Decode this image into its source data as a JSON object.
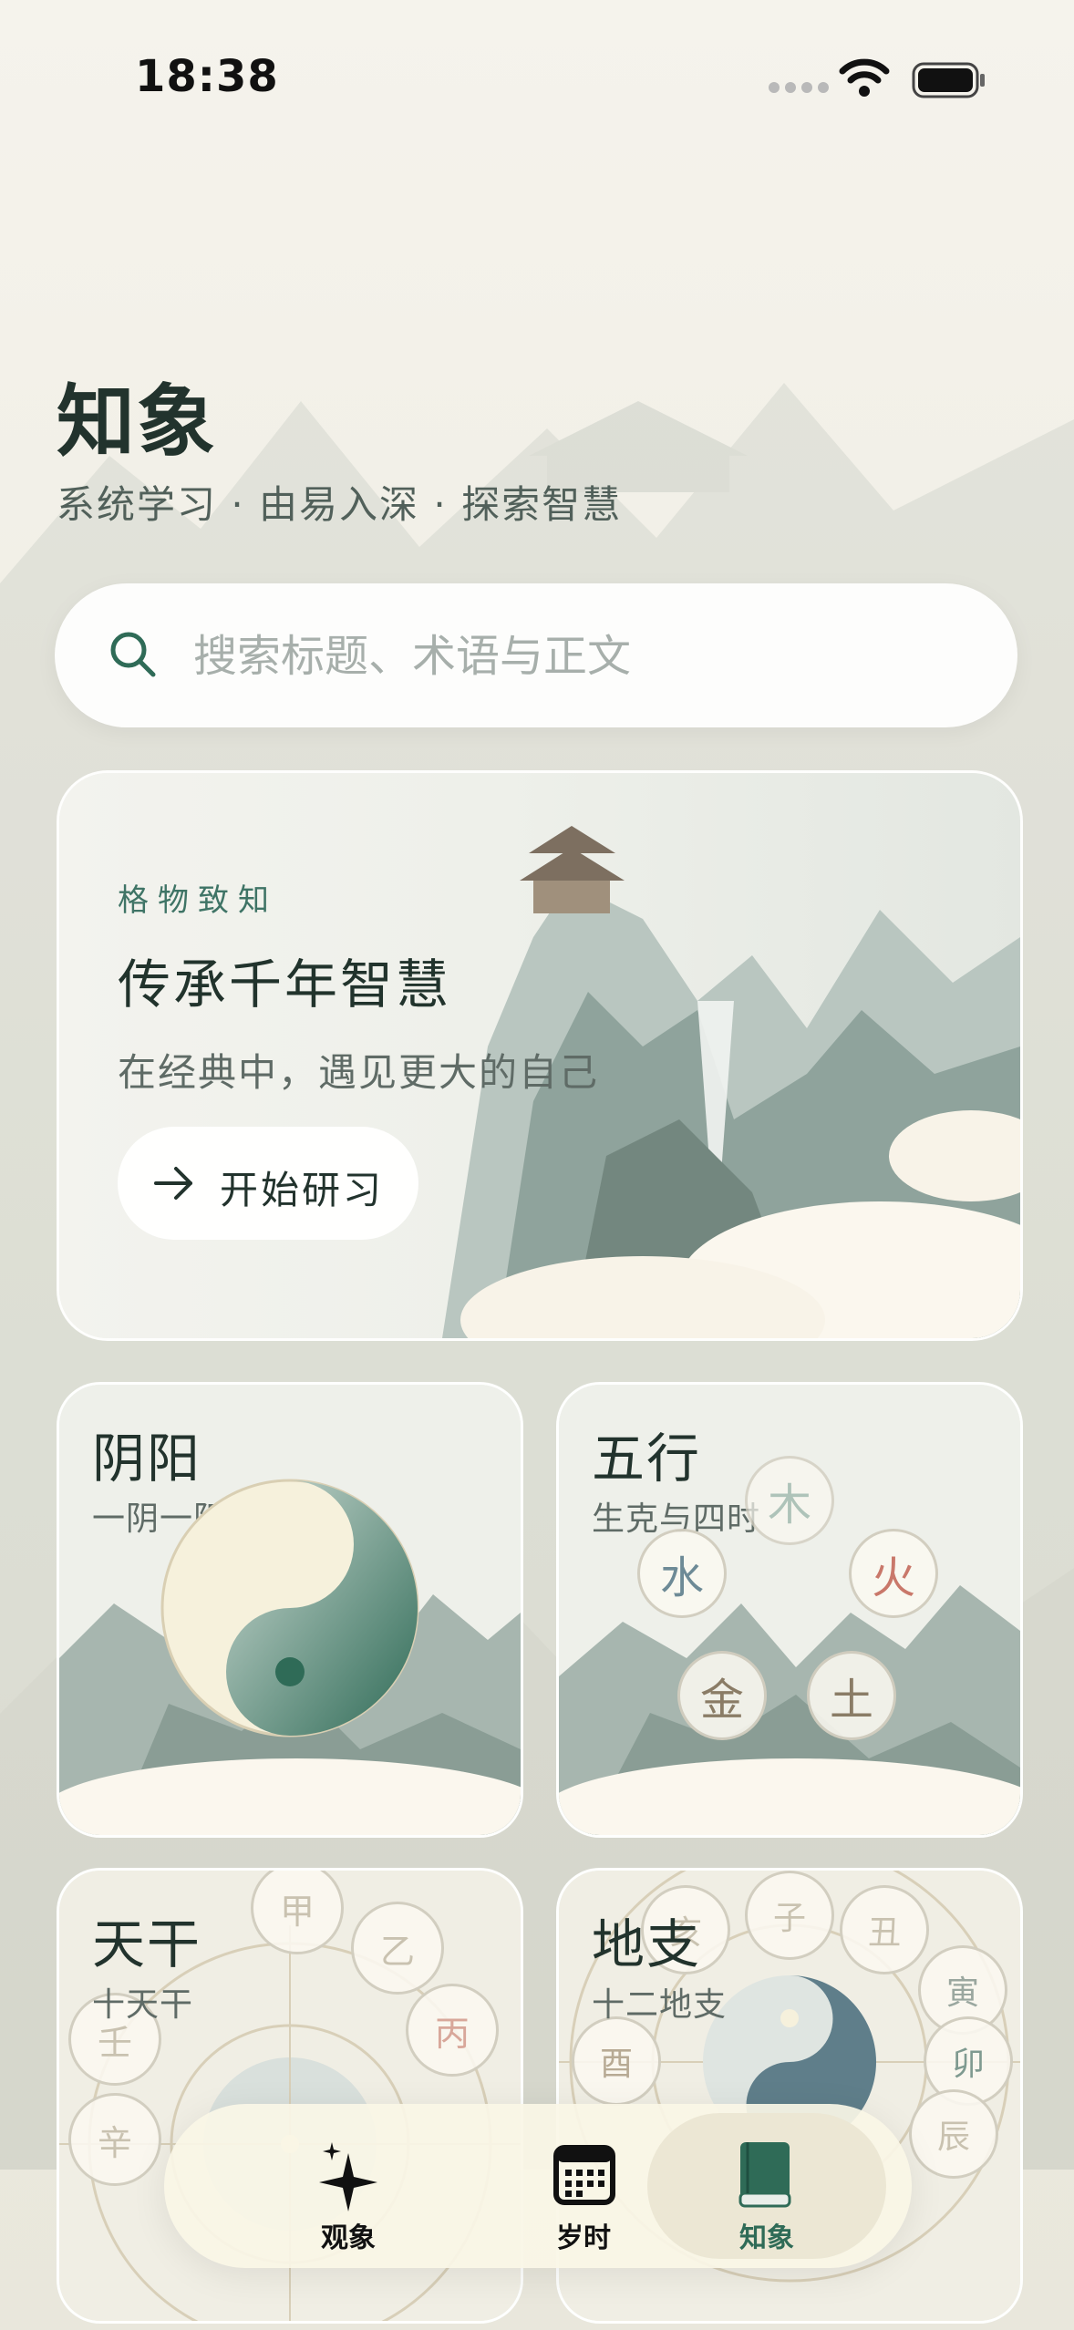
{
  "status_bar": {
    "time": "18:38"
  },
  "header": {
    "title": "知象",
    "subtitle": "系统学习 · 由易入深 · 探索智慧"
  },
  "search": {
    "placeholder": "搜索标题、术语与正文",
    "icon": "search-icon"
  },
  "hero": {
    "tag": "格物致知",
    "title": "传承千年智慧",
    "subtitle": "在经典中，遇见更大的自己",
    "button_label": "开始研习"
  },
  "cards": {
    "yinyang": {
      "title": "阴阳",
      "subtitle": "一阴一阳"
    },
    "wuxing": {
      "title": "五行",
      "subtitle": "生克与四时",
      "elements": {
        "wood": "木",
        "water": "水",
        "fire": "火",
        "metal": "金",
        "earth": "土"
      }
    },
    "tiangan": {
      "title": "天干",
      "subtitle": "十天干",
      "stems": {
        "jia": "甲",
        "yi": "乙",
        "bing": "丙",
        "ren": "壬",
        "xin": "辛"
      }
    },
    "dizhi": {
      "title": "地支",
      "subtitle": "十二地支",
      "branches": {
        "hai": "亥",
        "zi": "子",
        "chou": "丑",
        "yin": "寅",
        "you": "酉",
        "mao": "卯",
        "chen": "辰"
      }
    }
  },
  "tabbar": {
    "tabs": [
      {
        "label": "观象",
        "icon": "sparkle-icon"
      },
      {
        "label": "岁时",
        "icon": "calendar-icon"
      },
      {
        "label": "知象",
        "icon": "book-icon",
        "active": true
      }
    ]
  },
  "colors": {
    "accent": "#2f6b57",
    "title": "#22332d",
    "fire": "#c9786a"
  }
}
